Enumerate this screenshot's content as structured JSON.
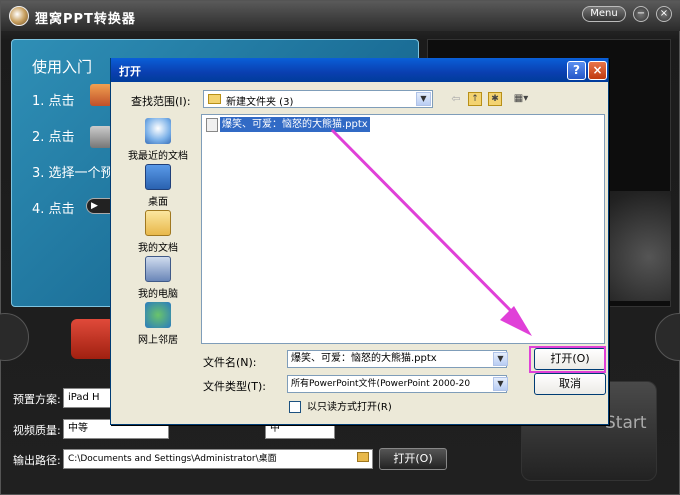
{
  "app": {
    "title": "狸窝PPT转换器",
    "menu_label": "Menu",
    "minimize_glyph": "−",
    "close_glyph": "×",
    "guide": {
      "title": "使用入门",
      "steps": [
        "1. 点击",
        "2. 点击",
        "3. 选择一个预",
        "4. 点击"
      ]
    },
    "preset_label": "预置方案:",
    "preset_value": "iPad H",
    "quality_label": "视频质量:",
    "quality_value": "中等",
    "size_value": "中",
    "output_label": "输出路径:",
    "output_path": "C:\\Documents and Settings\\Administrator\\桌面",
    "open_button": "打开(O)",
    "start_label": "Start"
  },
  "dialog": {
    "title": "打开",
    "help_glyph": "?",
    "close_glyph": "×",
    "look_in_label": "查找范围(I):",
    "look_in_value": "新建文件夹 (3)",
    "toolbar": {
      "back_glyph": "⇦",
      "up_glyph": "↑",
      "new_folder_glyph": "✱",
      "view_glyph": "▦▾"
    },
    "places": [
      {
        "label": "我最近的文档",
        "icon": "recent-docs-icon"
      },
      {
        "label": "桌面",
        "icon": "desktop-icon"
      },
      {
        "label": "我的文档",
        "icon": "my-documents-icon"
      },
      {
        "label": "我的电脑",
        "icon": "my-computer-icon"
      },
      {
        "label": "网上邻居",
        "icon": "network-places-icon"
      }
    ],
    "files": [
      {
        "name": "爆笑、可爱：恼怒的大熊猫.pptx",
        "selected": true
      }
    ],
    "file_name_label": "文件名(N):",
    "file_name_value": "爆笑、可爱：恼怒的大熊猫.pptx",
    "file_type_label": "文件类型(T):",
    "file_type_value": "所有PowerPoint文件(PowerPoint 2000-20",
    "read_only_label": "以只读方式打开(R)",
    "open_button": "打开(O)",
    "cancel_button": "取消",
    "highlight_color": "#e040d8"
  }
}
